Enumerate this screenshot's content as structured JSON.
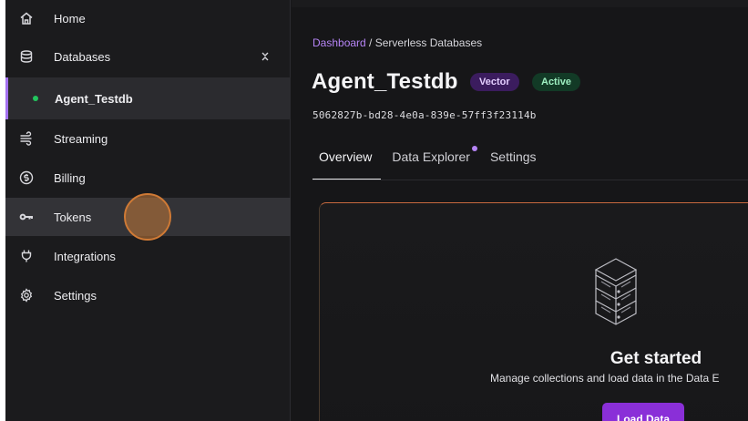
{
  "sidebar": {
    "items": [
      {
        "label": "Home",
        "icon": "home-icon"
      },
      {
        "label": "Databases",
        "icon": "database-icon"
      },
      {
        "label": "Agent_Testdb",
        "icon": "status-dot"
      },
      {
        "label": "Streaming",
        "icon": "streaming-icon"
      },
      {
        "label": "Billing",
        "icon": "billing-icon"
      },
      {
        "label": "Tokens",
        "icon": "key-icon"
      },
      {
        "label": "Integrations",
        "icon": "plug-icon"
      },
      {
        "label": "Settings",
        "icon": "gear-icon"
      }
    ]
  },
  "breadcrumb": {
    "link": "Dashboard",
    "separator": " / ",
    "current": "Serverless Databases"
  },
  "database": {
    "name": "Agent_Testdb",
    "type_badge": "Vector",
    "status_badge": "Active",
    "id": "5062827b-bd28-4e0a-839e-57ff3f23114b"
  },
  "tabs": [
    {
      "label": "Overview"
    },
    {
      "label": "Data Explorer"
    },
    {
      "label": "Settings"
    }
  ],
  "empty_state": {
    "title": "Get started",
    "description": "Manage collections and load data in the Data E",
    "button_label": "Load Data"
  },
  "colors": {
    "accent": "#8a2fd8",
    "link": "#b584f5",
    "active_dot": "#22c55e",
    "vector_badge_bg": "#3b1c5e",
    "active_badge_bg": "#123a26"
  }
}
